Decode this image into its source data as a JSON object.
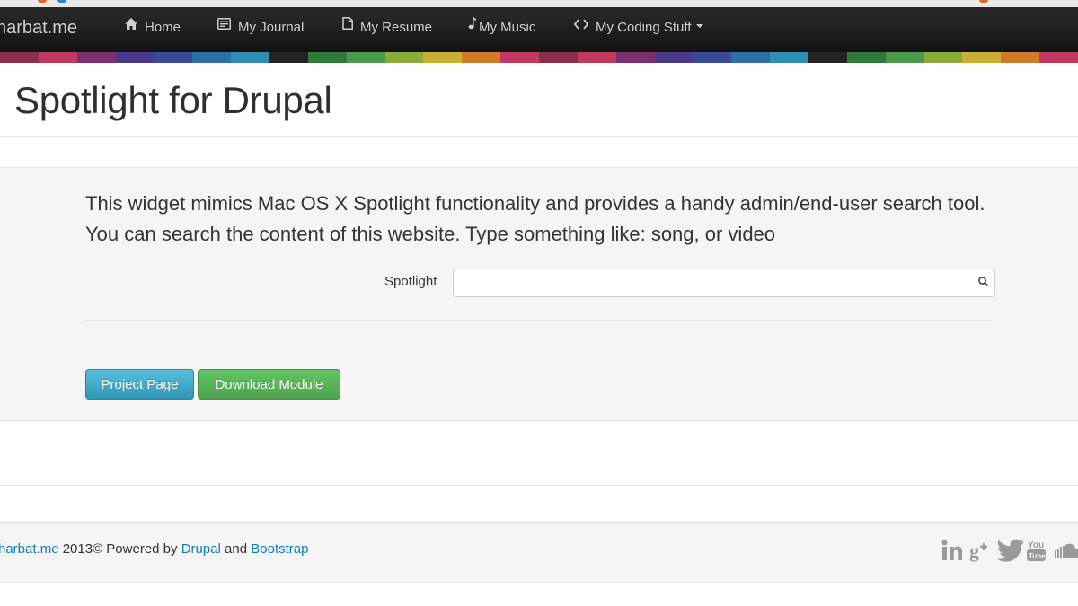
{
  "navbar": {
    "brand": "harbat.me",
    "items": [
      {
        "label": "Home",
        "icon": "home-icon"
      },
      {
        "label": "My Journal",
        "icon": "journal-icon"
      },
      {
        "label": "My Resume",
        "icon": "file-icon"
      },
      {
        "label": "My Music",
        "icon": "music-note-icon"
      },
      {
        "label": "My Coding Stuff",
        "icon": "code-icon"
      }
    ]
  },
  "colorbar": [
    "#8b2e4c",
    "#c23a5f",
    "#7a2f6e",
    "#4a3a8a",
    "#3a4a9a",
    "#2f6fa8",
    "#2e8fb3",
    "#232323",
    "#2f7a3a",
    "#4a9a4a",
    "#8aaa3a",
    "#c9b032",
    "#d27a2a",
    "#c23a5f",
    "#8b2e4c",
    "#c23a5f",
    "#7a2f6e",
    "#4a3a8a",
    "#3a4a9a",
    "#2f6fa8",
    "#2e8fb3",
    "#232323",
    "#2f7a3a",
    "#4a9a4a",
    "#8aaa3a",
    "#c9b032",
    "#d27a2a",
    "#c23a5f"
  ],
  "page": {
    "title": "Spotlight for Drupal",
    "intro": "This widget mimics Mac OS X Spotlight functionality and provides a handy admin/end-user search tool. You can search the content of this website. Type something like: song, or video",
    "spotlight_label": "Spotlight",
    "spotlight_value": ""
  },
  "buttons": {
    "project_page": "Project Page",
    "download_module": "Download Module"
  },
  "footer": {
    "site_link": "harbat.me",
    "year_text": " 2013© Powered by ",
    "drupal_link": "Drupal",
    "and_text": " and ",
    "bootstrap_link": "Bootstrap",
    "social_icons": [
      "linkedin-icon",
      "google-plus-icon",
      "twitter-icon",
      "youtube-icon",
      "soundcloud-icon"
    ]
  }
}
